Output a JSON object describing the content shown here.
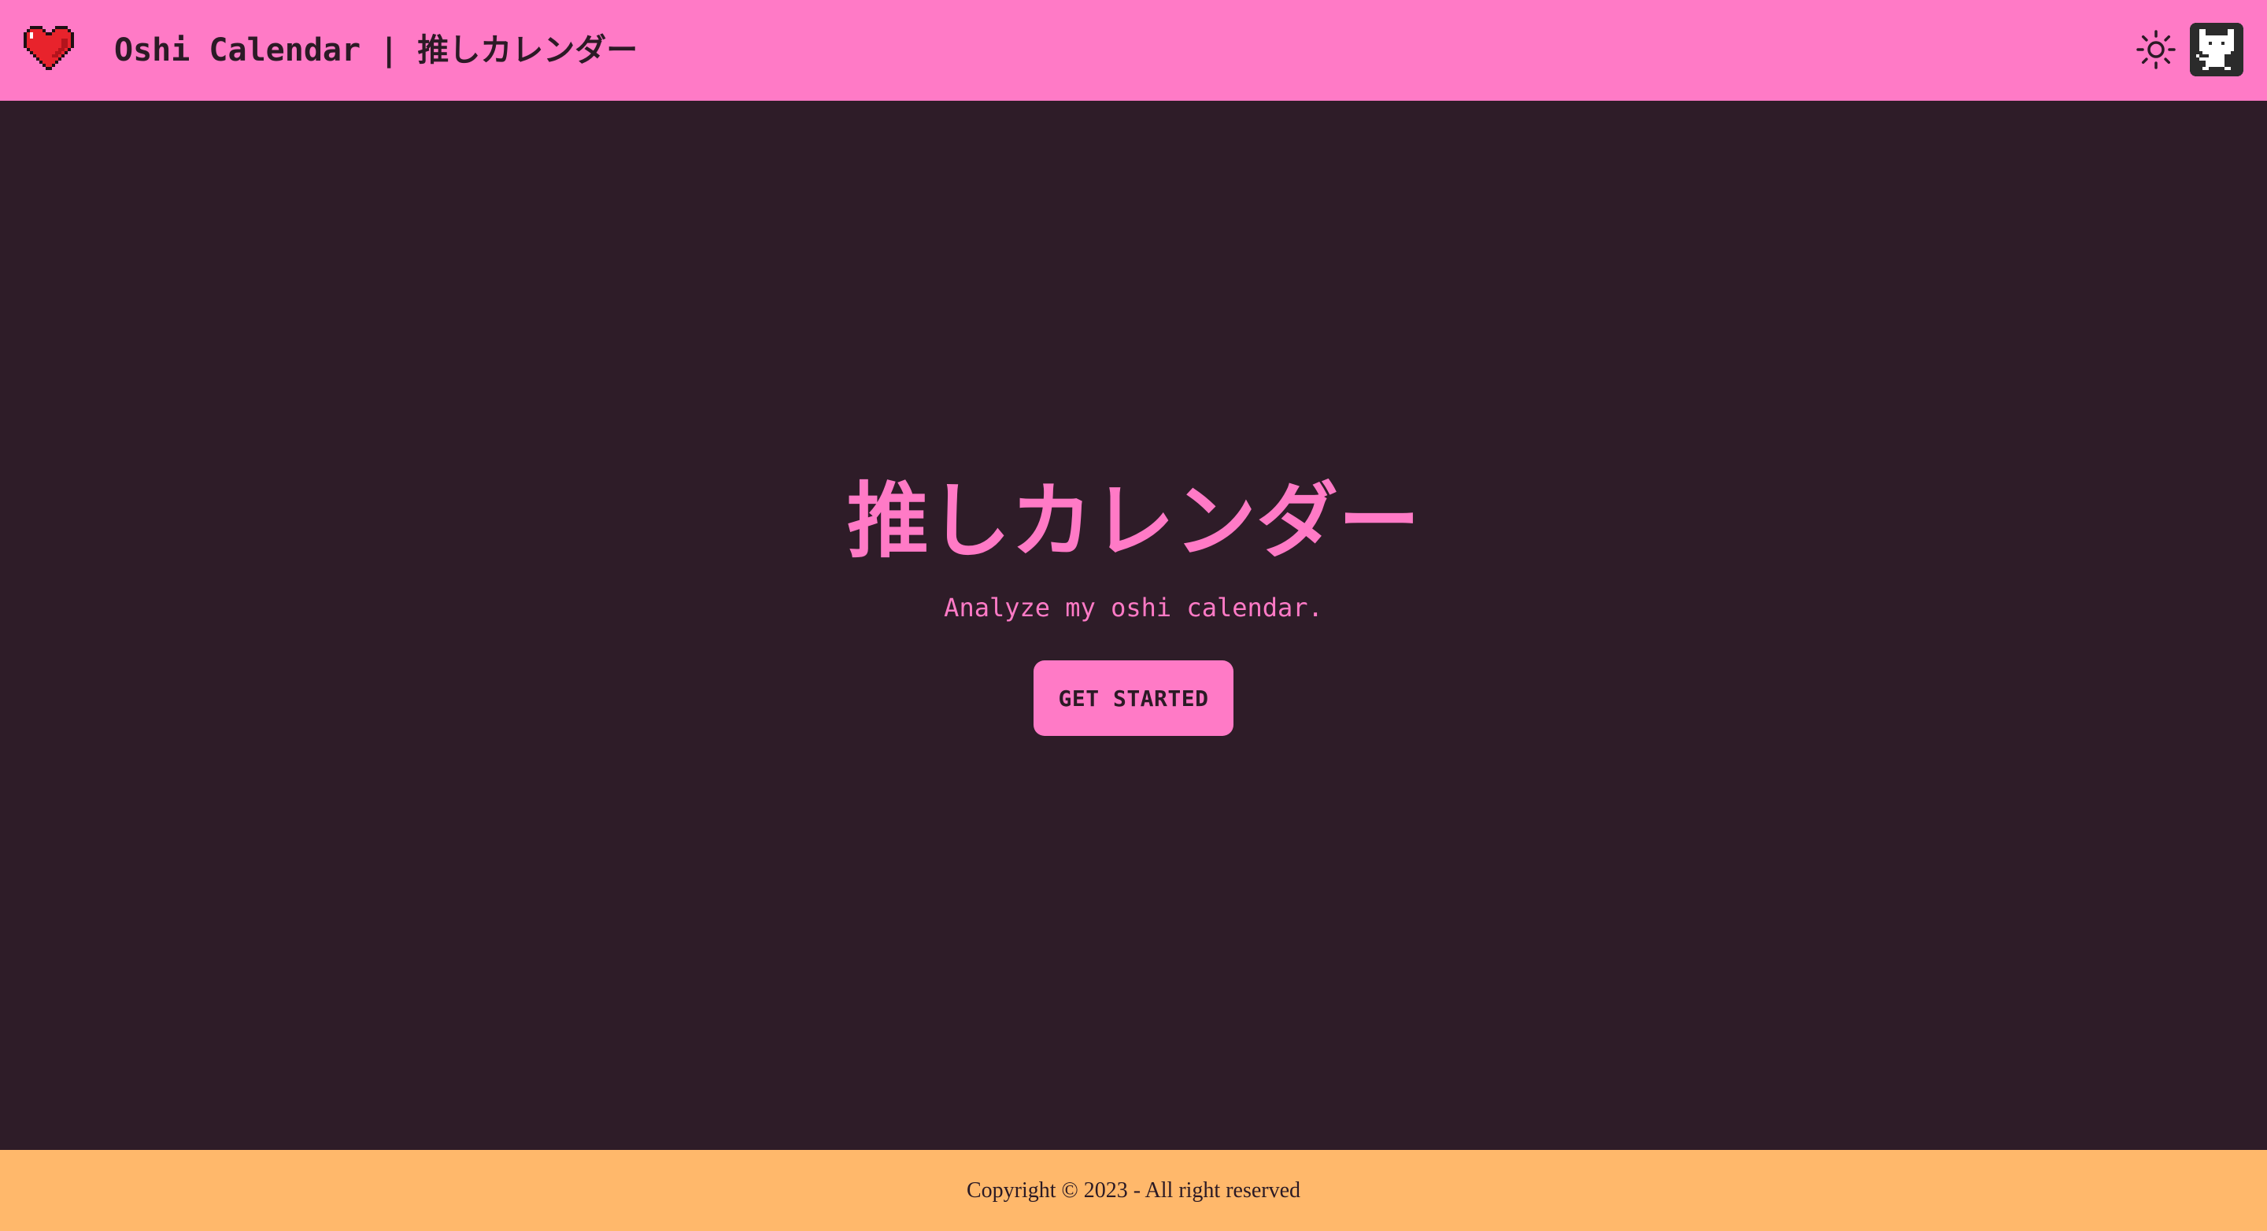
{
  "header": {
    "logo_icon": "pixel-heart-icon",
    "brand_title": "Oshi Calendar | 推しカレンダー",
    "theme_toggle_icon": "sun-icon",
    "github_icon": "github-octocat-icon"
  },
  "hero": {
    "title": "推しカレンダー",
    "subtitle": "Analyze my oshi calendar.",
    "cta_label": "GET STARTED"
  },
  "footer": {
    "copyright": "Copyright © 2023 - All right reserved"
  },
  "colors": {
    "background": "#2e1c28",
    "primary_pink": "#ff7ac6",
    "footer_orange": "#ffb86b",
    "dark_text": "#2b1a25",
    "heart_red": "#e8232c"
  }
}
